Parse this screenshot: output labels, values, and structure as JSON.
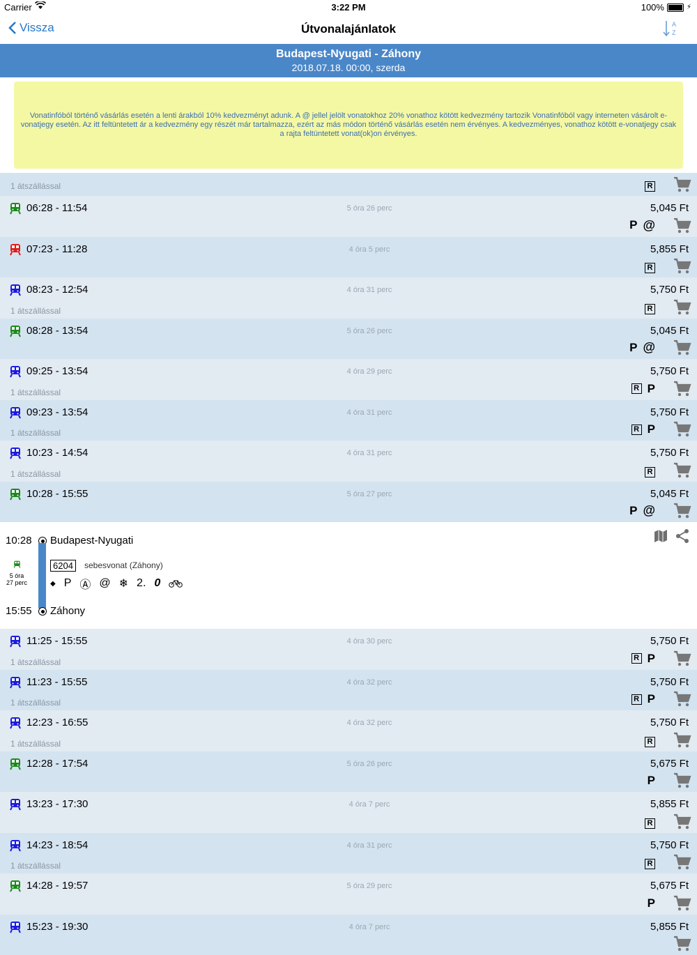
{
  "status": {
    "carrier": "Carrier",
    "time": "3:22 PM",
    "battery": "100%"
  },
  "nav": {
    "back": "Vissza",
    "title": "Útvonalajánlatok"
  },
  "route": {
    "name": "Budapest-Nyugati - Záhony",
    "date": "2018.07.18. 00:00, szerda"
  },
  "notice": "Vonatinfóból történő vásárlás esetén a lenti árakból 10% kedvezményt adunk. A @ jellel jelölt vonatokhoz 20% vonathoz kötött kedvezmény tartozik Vonatinfóból vagy interneten vásárolt e-vonatjegy esetén. Az itt feltüntetett ár a kedvezmény egy részét már tartalmazza, ezért az más módon történő vásárlás esetén nem érvényes. A kedvezményes, vonathoz kötött e-vonatjegy csak a rajta feltüntetett vonat(ok)on érvényes.",
  "colors": {
    "green": "#1a8a1a",
    "red": "#e01b1b",
    "blue": "#1a1ae0",
    "header": "#4a87c9",
    "accent": "#2777c9"
  },
  "stub": {
    "transfer": "1 átszállással",
    "features": [
      "R"
    ]
  },
  "rows_top": [
    {
      "color": "green",
      "times": "06:28 - 11:54",
      "duration": "5 óra 26 perc",
      "price": "5,045 Ft",
      "transfer": "",
      "features": [
        "P",
        "@"
      ]
    },
    {
      "color": "red",
      "times": "07:23 - 11:28",
      "duration": "4 óra 5 perc",
      "price": "5,855 Ft",
      "transfer": "",
      "features": [
        "R"
      ]
    },
    {
      "color": "blue",
      "times": "08:23 - 12:54",
      "duration": "4 óra 31 perc",
      "price": "5,750 Ft",
      "transfer": "1 átszállással",
      "features": [
        "R"
      ]
    },
    {
      "color": "green",
      "times": "08:28 - 13:54",
      "duration": "5 óra 26 perc",
      "price": "5,045 Ft",
      "transfer": "",
      "features": [
        "P",
        "@"
      ]
    },
    {
      "color": "blue",
      "times": "09:25 - 13:54",
      "duration": "4 óra 29 perc",
      "price": "5,750 Ft",
      "transfer": "1 átszállással",
      "features": [
        "R",
        "P"
      ]
    },
    {
      "color": "blue",
      "times": "09:23 - 13:54",
      "duration": "4 óra 31 perc",
      "price": "5,750 Ft",
      "transfer": "1 átszállással",
      "features": [
        "R",
        "P"
      ]
    },
    {
      "color": "blue",
      "times": "10:23 - 14:54",
      "duration": "4 óra 31 perc",
      "price": "5,750 Ft",
      "transfer": "1 átszállással",
      "features": [
        "R"
      ]
    },
    {
      "color": "green",
      "times": "10:28 - 15:55",
      "duration": "5 óra 27 perc",
      "price": "5,045 Ft",
      "transfer": "",
      "features": [
        "P",
        "@"
      ]
    }
  ],
  "detail": {
    "dep_time": "10:28",
    "dep_station": "Budapest-Nyugati",
    "arr_time": "15:55",
    "arr_station": "Záhony",
    "duration_line1": "5 óra",
    "duration_line2": "27 perc",
    "train_no": "6204",
    "train_type": "sebesvonat (Záhony)",
    "amenities": [
      "◆",
      "P",
      "Ⓐ",
      "@",
      "❄",
      "2.",
      "0",
      "bicycle"
    ]
  },
  "rows_bottom": [
    {
      "color": "blue",
      "times": "11:25 - 15:55",
      "duration": "4 óra 30 perc",
      "price": "5,750 Ft",
      "transfer": "1 átszállással",
      "features": [
        "R",
        "P"
      ]
    },
    {
      "color": "blue",
      "times": "11:23 - 15:55",
      "duration": "4 óra 32 perc",
      "price": "5,750 Ft",
      "transfer": "1 átszállással",
      "features": [
        "R",
        "P"
      ]
    },
    {
      "color": "blue",
      "times": "12:23 - 16:55",
      "duration": "4 óra 32 perc",
      "price": "5,750 Ft",
      "transfer": "1 átszállással",
      "features": [
        "R"
      ]
    },
    {
      "color": "green",
      "times": "12:28 - 17:54",
      "duration": "5 óra 26 perc",
      "price": "5,675 Ft",
      "transfer": "",
      "features": [
        "P"
      ]
    },
    {
      "color": "blue",
      "times": "13:23 - 17:30",
      "duration": "4 óra 7 perc",
      "price": "5,855 Ft",
      "transfer": "",
      "features": [
        "R"
      ]
    },
    {
      "color": "blue",
      "times": "14:23 - 18:54",
      "duration": "4 óra 31 perc",
      "price": "5,750 Ft",
      "transfer": "1 átszállással",
      "features": [
        "R"
      ]
    },
    {
      "color": "green",
      "times": "14:28 - 19:57",
      "duration": "5 óra 29 perc",
      "price": "5,675 Ft",
      "transfer": "",
      "features": [
        "P"
      ]
    },
    {
      "color": "blue",
      "times": "15:23 - 19:30",
      "duration": "4 óra 7 perc",
      "price": "5,855 Ft",
      "transfer": "",
      "features": []
    }
  ]
}
